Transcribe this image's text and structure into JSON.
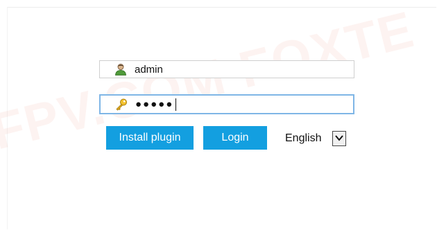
{
  "watermark": {
    "text": "FPV.COM  FOXTE"
  },
  "login": {
    "username": {
      "icon": "user-icon",
      "value": "admin"
    },
    "password": {
      "icon": "key-icon",
      "masked_value": "●●●●●"
    },
    "install_plugin_label": "Install plugin",
    "login_label": "Login",
    "language": {
      "selected": "English",
      "arrow_icon": "chevron-down-icon"
    }
  },
  "colors": {
    "button_blue": "#139fe0",
    "focus_border": "#7fb6e6"
  }
}
